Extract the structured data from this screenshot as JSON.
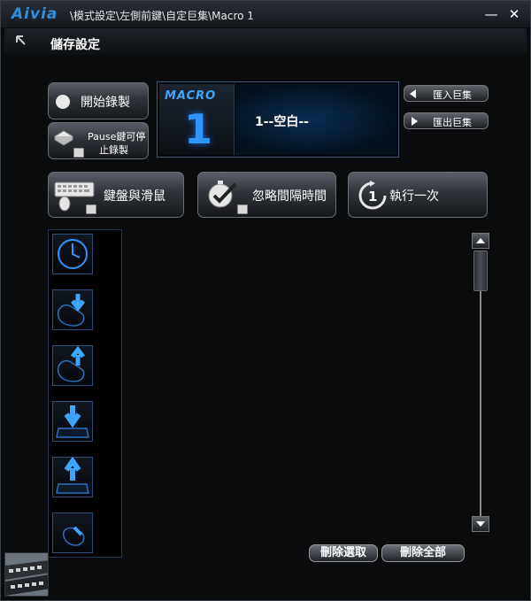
{
  "window": {
    "logo": "Aivia",
    "title": "\\模式設定\\左側前鍵\\自定巨集\\Macro 1",
    "minimize": "—",
    "close": "✕"
  },
  "section": {
    "title": "儲存設定"
  },
  "record": {
    "start_label": "開始錄製",
    "pause_line1": "Pause鍵可停",
    "pause_line2": "止錄製"
  },
  "macro": {
    "logo_word": "MACRO",
    "number": "1",
    "name": "1--空白--"
  },
  "import_export": {
    "import_label": "匯入巨集",
    "export_label": "匯出巨集"
  },
  "tools": {
    "keyboard_mouse": "鍵盤與滑鼠",
    "ignore_interval": "忽略間隔時間",
    "run_once_num": "1",
    "run_once": "執行一次"
  },
  "events": [
    {
      "icon": "clock-delay-icon"
    },
    {
      "icon": "mouse-button-down-icon"
    },
    {
      "icon": "mouse-button-up-icon"
    },
    {
      "icon": "key-down-icon"
    },
    {
      "icon": "key-up-icon"
    },
    {
      "icon": "mouse-button-icon"
    }
  ],
  "actions": {
    "delete_selected": "刪除選取",
    "delete_all": "刪除全部"
  },
  "colors": {
    "accent": "#2f95ff",
    "background": "#0a0b0d"
  }
}
